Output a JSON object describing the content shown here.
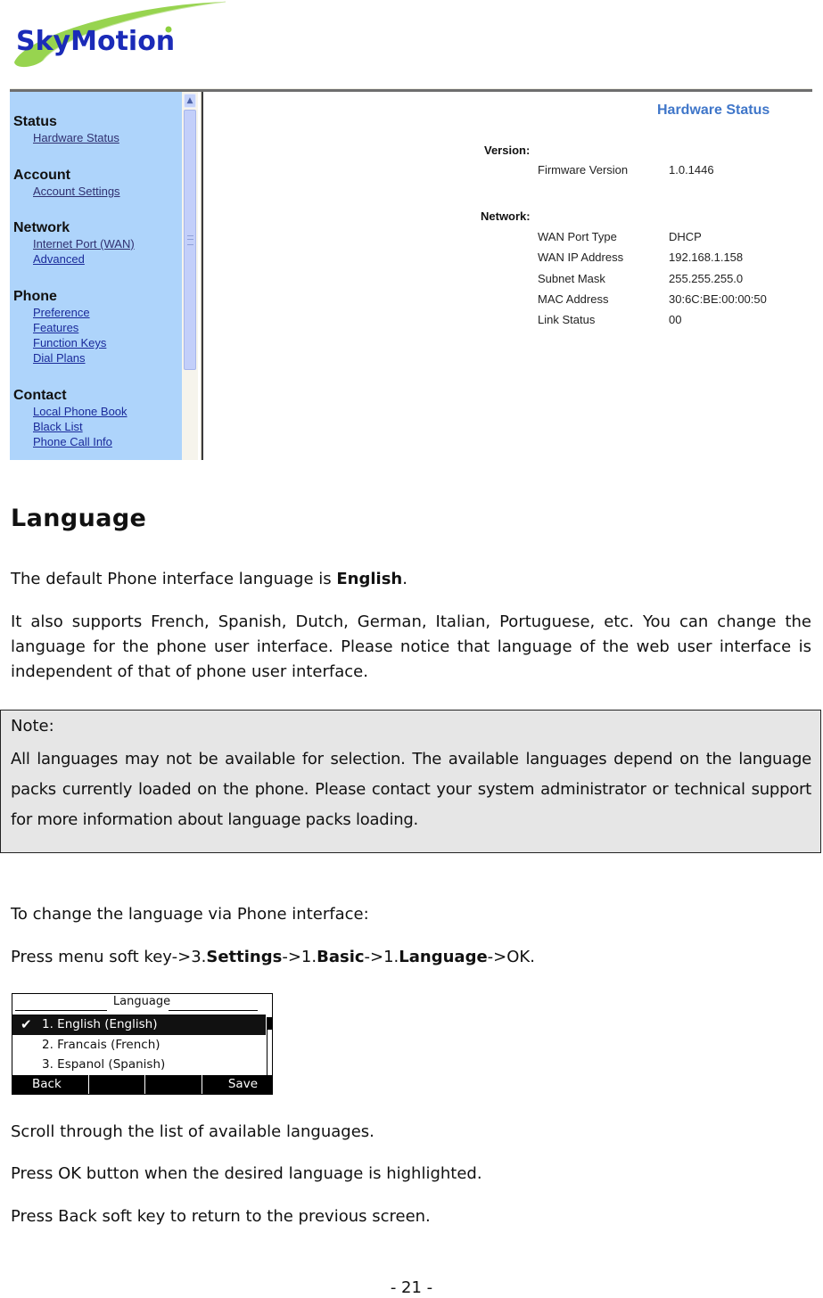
{
  "logo": {
    "brand": "SkyMotion",
    "colors": {
      "text": "#1b2bb8",
      "swoosh": "#8ccf3c"
    }
  },
  "web_ui": {
    "sidebar": {
      "groups": [
        {
          "heading": "Status",
          "links": [
            "Hardware Status"
          ]
        },
        {
          "heading": "Account",
          "links": [
            "Account Settings"
          ]
        },
        {
          "heading": "Network",
          "links": [
            "Internet Port (WAN)",
            "Advanced"
          ]
        },
        {
          "heading": "Phone",
          "links": [
            "Preference",
            "Features",
            "Function Keys",
            "Dial Plans"
          ]
        },
        {
          "heading": "Contact",
          "links": [
            "Local Phone Book",
            "Black List",
            "Phone Call Info"
          ]
        }
      ]
    },
    "content": {
      "title": "Hardware Status",
      "sections": [
        {
          "label": "Version:",
          "rows": [
            {
              "key": "Firmware Version",
              "value": "1.0.1446"
            }
          ]
        },
        {
          "label": "Network:",
          "rows": [
            {
              "key": "WAN Port Type",
              "value": "DHCP"
            },
            {
              "key": "WAN IP Address",
              "value": "192.168.1.158"
            },
            {
              "key": "Subnet Mask",
              "value": "255.255.255.0"
            },
            {
              "key": "MAC Address",
              "value": "30:6C:BE:00:00:50"
            },
            {
              "key": "Link Status",
              "value": "00"
            }
          ]
        }
      ],
      "title_color": "#3f76c9"
    }
  },
  "doc": {
    "heading": "Language",
    "p1_prefix": "The default Phone interface language is ",
    "p1_bold": "English",
    "p1_suffix": ".",
    "p2": "It also supports French, Spanish, Dutch, German, Italian, Portuguese, etc. You can change the language for the phone user interface. Please notice that language of the web user interface is independent of that of phone user interface.",
    "note_label": "Note:",
    "note_body": "All languages may not be available for selection. The available languages depend on the language packs currently loaded on the phone. Please contact your system administrator or technical support for more information about language packs loading.",
    "p3": "To change the language via Phone interface:",
    "p4_parts": [
      "Press menu soft key->3.",
      "Settings",
      "->1.",
      "Basic",
      "->1.",
      "Language",
      "->OK."
    ],
    "p5": "Scroll through the list of available languages.",
    "p6": "Press OK button when the desired language is highlighted.",
    "p7": "Press Back soft key to return to the previous screen.",
    "page_number": "- 21 -"
  },
  "phone_screen": {
    "title": "Language",
    "items": [
      {
        "label": "1. English (English)",
        "selected": true,
        "checked": true
      },
      {
        "label": "2. Francais (French)",
        "selected": false,
        "checked": false
      },
      {
        "label": "3. Espanol (Spanish)",
        "selected": false,
        "checked": false
      }
    ],
    "check_icon": "✔",
    "softkeys": [
      "Back",
      "",
      "",
      "Save"
    ]
  }
}
